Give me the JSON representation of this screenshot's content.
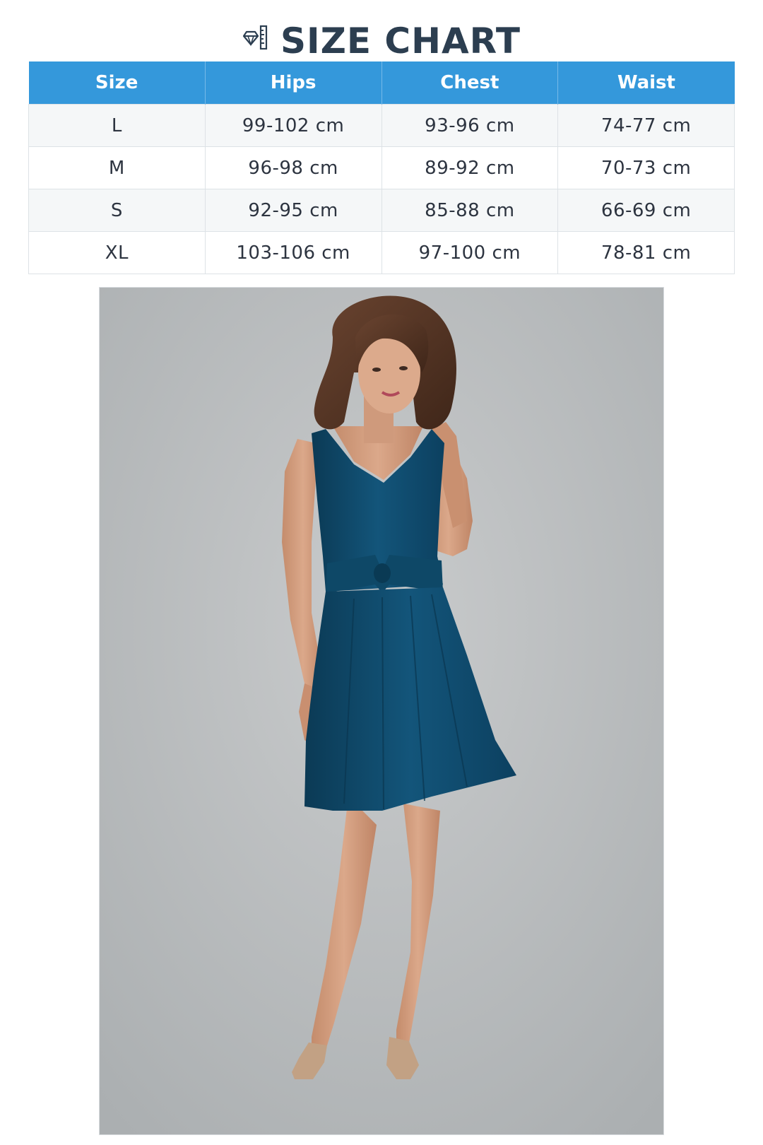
{
  "header": {
    "title": "SIZE CHART",
    "icon": "ruler-icon"
  },
  "table": {
    "columns": [
      "Size",
      "Hips",
      "Chest",
      "Waist"
    ],
    "rows": [
      [
        "L",
        "99-102 cm",
        "93-96 cm",
        "74-77 cm"
      ],
      [
        "M",
        "96-98 cm",
        "89-92 cm",
        "70-73 cm"
      ],
      [
        "S",
        "92-95 cm",
        "85-88 cm",
        "66-69 cm"
      ],
      [
        "XL",
        "103-106 cm",
        "97-100 cm",
        "78-81 cm"
      ]
    ]
  },
  "colors": {
    "header_bg": "#3498db",
    "title": "#2c3e50",
    "dress": "#0f4a6b",
    "photo_bg": "#bcbfc1"
  },
  "photo": {
    "subject": "model-in-navy-dress"
  }
}
